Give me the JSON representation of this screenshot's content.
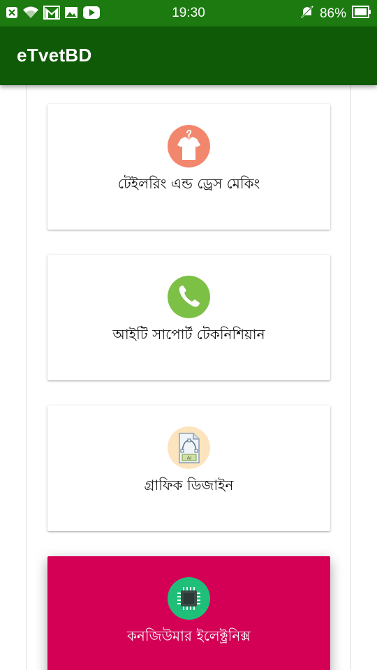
{
  "status_bar": {
    "time": "19:30",
    "battery": "86%",
    "icons": [
      "notification-close-icon",
      "wifi-icon",
      "gmail-icon",
      "image-icon",
      "youtube-icon",
      "mute-icon",
      "battery-icon"
    ]
  },
  "app_bar": {
    "title": "eTvetBD"
  },
  "courses": [
    {
      "label": "টেইলরিং এন্ড ড্রেস মেকিং",
      "icon": "shirt-icon",
      "icon_bg": "#f2876d"
    },
    {
      "label": "আইটি সাপোর্ট টেকনিশিয়ান",
      "icon": "phone-icon",
      "icon_bg": "#7cc046"
    },
    {
      "label": "গ্রাফিক ডিজাইন",
      "icon": "design-file-icon",
      "icon_bg": "#fce4bf"
    },
    {
      "label": "কনজিউমার ইলেক্ট্রনিক্স",
      "icon": "chip-icon",
      "icon_bg": "#1fbf7a",
      "selected": true
    }
  ],
  "colors": {
    "status_bar": "#1c7a10",
    "app_bar": "#0f5a06",
    "selected_card": "#d40056"
  }
}
